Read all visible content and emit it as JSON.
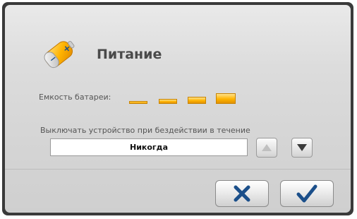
{
  "window": {
    "title": "Питание"
  },
  "battery": {
    "capacity_label": "Емкость батареи:",
    "bars_total": 4,
    "bars_filled": 4
  },
  "timeout": {
    "label": "Выключать устройство при бездействии в течение",
    "value": "Никогда",
    "up_enabled": false,
    "down_enabled": true
  },
  "icons": {
    "app": "battery-icon",
    "up": "arrow-up-icon",
    "down": "arrow-down-icon",
    "cancel": "cross-icon",
    "ok": "checkmark-icon"
  },
  "colors": {
    "accent_orange": "#ffb300",
    "cancel_blue": "#1b4f8a",
    "ok_blue": "#1b4f8a",
    "disabled_gray": "#c0c0c0"
  }
}
